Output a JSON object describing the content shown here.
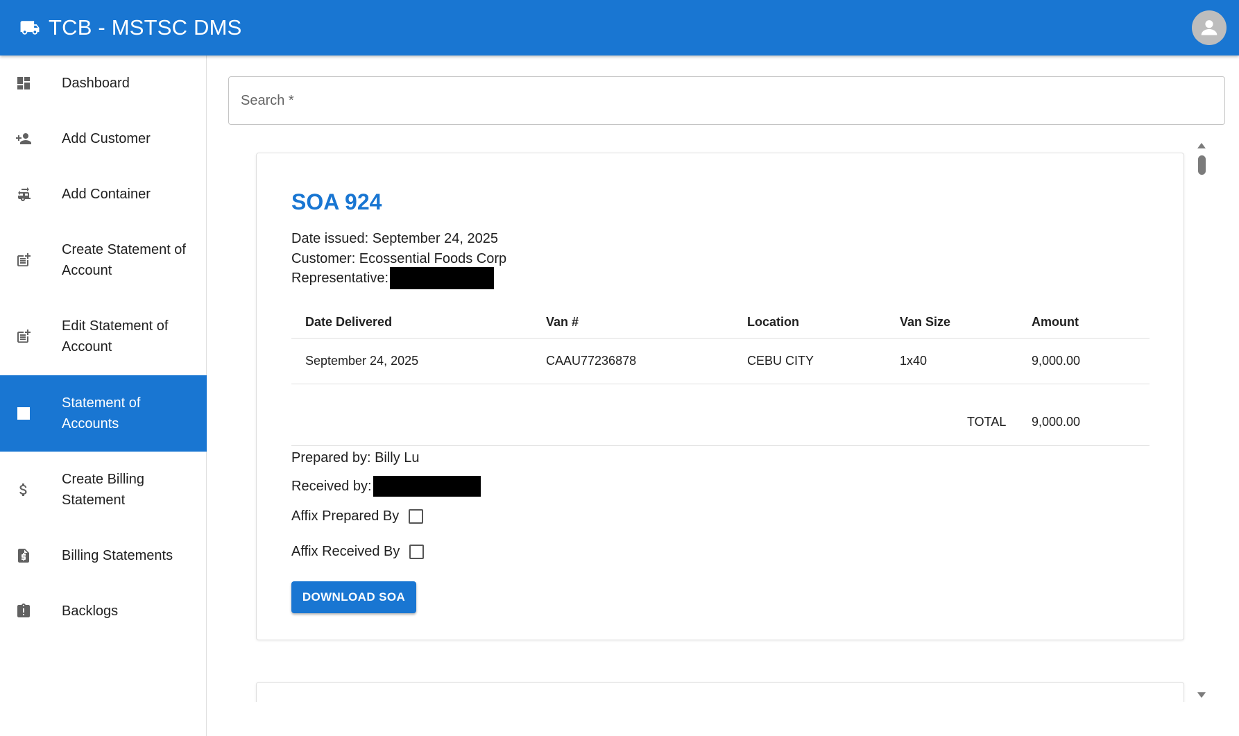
{
  "app": {
    "title": "TCB - MSTSC DMS",
    "brand_color": "#1976d2",
    "logo_icon": "truck-icon",
    "user_icon": "account-circle-icon"
  },
  "sidebar": {
    "items": [
      {
        "label": "Dashboard",
        "icon": "dashboard-icon",
        "active": false
      },
      {
        "label": "Add Customer",
        "icon": "person-add-icon",
        "active": false
      },
      {
        "label": "Add Container",
        "icon": "rv-hookup-icon",
        "active": false
      },
      {
        "label": "Create Statement of Account",
        "icon": "post-add-icon",
        "active": false
      },
      {
        "label": "Edit Statement of Account",
        "icon": "post-add-icon",
        "active": false
      },
      {
        "label": "Statement of Accounts",
        "icon": "list-alt-icon",
        "active": true
      },
      {
        "label": "Create Billing Statement",
        "icon": "dollar-icon",
        "active": false
      },
      {
        "label": "Billing Statements",
        "icon": "request-quote-icon",
        "active": false
      },
      {
        "label": "Backlogs",
        "icon": "assignment-late-icon",
        "active": false
      }
    ]
  },
  "search": {
    "placeholder": "Search *",
    "value": ""
  },
  "soa": {
    "title": "SOA 924",
    "date_issued": "Date issued: September 24, 2025",
    "customer": "Customer: Ecossential Foods Corp",
    "representative_label": "Representative:",
    "table": {
      "headers": [
        "Date Delivered",
        "Van #",
        "Location",
        "Van Size",
        "Amount"
      ],
      "rows": [
        [
          "September 24, 2025",
          "CAAU77236878",
          "CEBU CITY",
          "1x40",
          "9,000.00"
        ]
      ],
      "total_label": "TOTAL",
      "total_value": "9,000.00"
    },
    "prepared_by": "Prepared by: Billy Lu",
    "received_by_label": "Received by:",
    "affix_prepared_label": "Affix Prepared By",
    "affix_prepared_checked": false,
    "affix_received_label": "Affix Received By",
    "affix_received_checked": false,
    "download_label": "DOWNLOAD SOA"
  }
}
